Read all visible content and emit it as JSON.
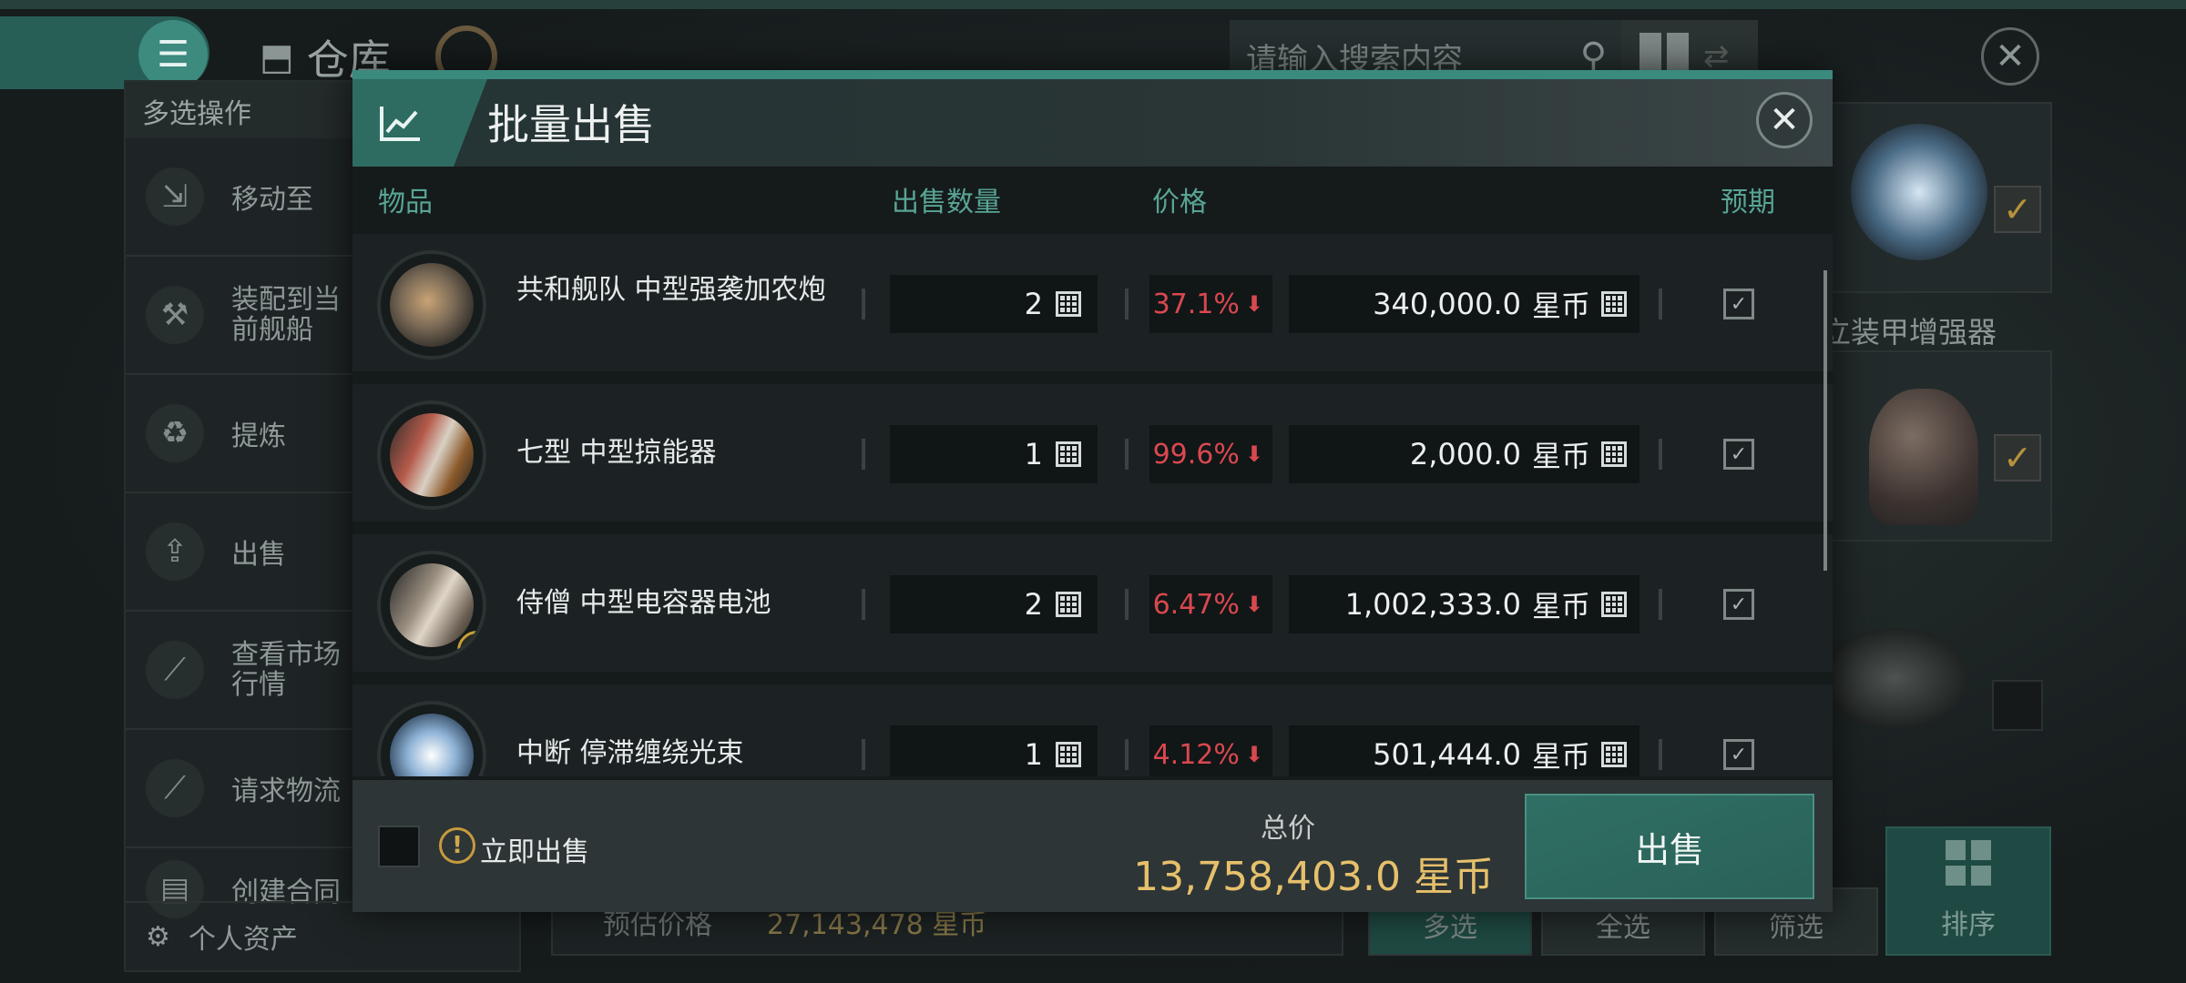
{
  "background": {
    "warehouse_title": "仓库",
    "search_placeholder": "请输入搜索内容",
    "multi_select_header": "多选操作",
    "left_menu": [
      {
        "label": "移动至",
        "icon": "move-to-icon"
      },
      {
        "label": "装配到当前舰船",
        "icon": "fit-to-ship-icon"
      },
      {
        "label": "提炼",
        "icon": "recycle-icon"
      },
      {
        "label": "出售",
        "icon": "sell-icon"
      },
      {
        "label": "查看市场行情",
        "icon": "market-chart-icon"
      },
      {
        "label": "请求物流",
        "icon": "logistics-chart-icon"
      },
      {
        "label": "创建合同",
        "icon": "contract-icon"
      }
    ],
    "personal_assets": "个人资产",
    "estimated_price_label": "预估价格",
    "estimated_price_value": "27,143,478 星币",
    "footer_buttons": [
      "多选",
      "全选",
      "筛选",
      "排序"
    ],
    "card_label": "立装甲增强器"
  },
  "modal": {
    "title": "批量出售",
    "columns": {
      "item": "物品",
      "quantity": "出售数量",
      "price": "价格",
      "expect": "预期"
    },
    "rows": [
      {
        "name": "共和舰队 中型强袭加农炮",
        "quantity": "2",
        "percent": "37.1%",
        "price": "340,000.0",
        "unit": "星币"
      },
      {
        "name": "七型 中型掠能器",
        "quantity": "1",
        "percent": "99.6%",
        "price": "2,000.0",
        "unit": "星币"
      },
      {
        "name": "侍僧 中型电容器电池",
        "quantity": "2",
        "percent": "6.47%",
        "price": "1,002,333.0",
        "unit": "星币"
      },
      {
        "name": "中断 停滞缠绕光束",
        "quantity": "1",
        "percent": "4.12%",
        "price": "501,444.0",
        "unit": "星币"
      }
    ],
    "instant_sell_label": "立即出售",
    "total_label": "总价",
    "total_value": "13,758,403.0 星币",
    "sell_button": "出售"
  },
  "colors": {
    "accent": "#2e6c62",
    "price_drop": "#d9484f",
    "total_gold": "#e6c06b",
    "column_header": "#58a595"
  }
}
